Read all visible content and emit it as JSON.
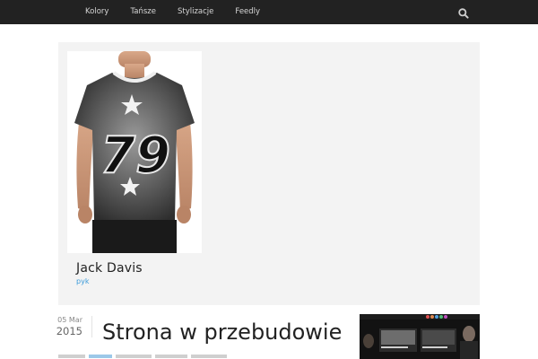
{
  "nav": {
    "items": [
      {
        "label": "Kolory"
      },
      {
        "label": "Tańsze"
      },
      {
        "label": "Stylizacje"
      },
      {
        "label": "Feedly"
      }
    ]
  },
  "feature": {
    "product_number": "79",
    "author_name": "Jack Davis",
    "author_subtitle": "pyk"
  },
  "post": {
    "date_day": "05 Mar",
    "date_year": "2015",
    "title": "Strona w przebudowie"
  },
  "colors": {
    "topbar": "#222222",
    "accent": "#3a9ad9",
    "feature_bg": "#f3f3f3"
  },
  "icons": {
    "search": "search-icon"
  }
}
